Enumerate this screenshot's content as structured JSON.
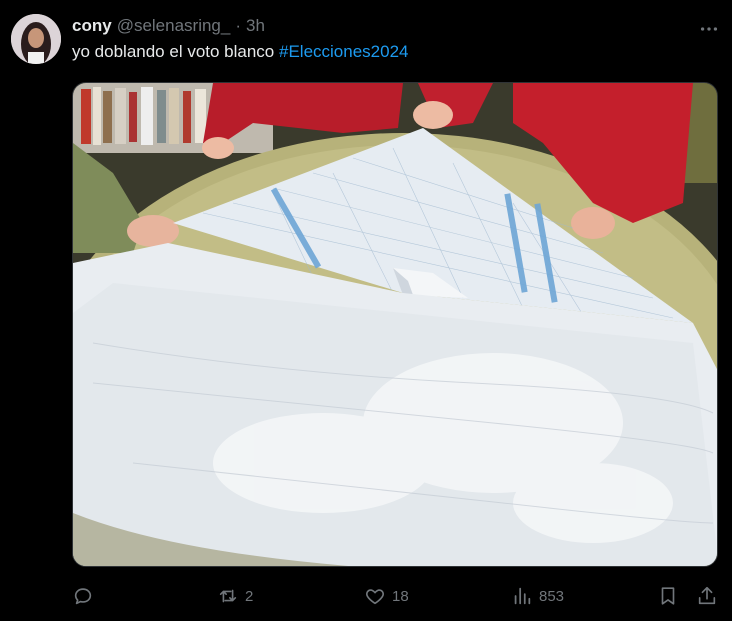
{
  "author": {
    "display_name": "cony",
    "handle": "@selenasring_",
    "separator": "·",
    "time": "3h"
  },
  "tweet": {
    "text": "yo doblando el voto blanco ",
    "hashtag": "#Elecciones2024"
  },
  "actions": {
    "replies": "",
    "retweets": "2",
    "likes": "18",
    "views": "853"
  },
  "colors": {
    "background": "#000000",
    "text": "#e7e9ea",
    "muted": "#71767b",
    "link": "#1d9bf0"
  },
  "icons": [
    "more-icon",
    "reply-icon",
    "retweet-icon",
    "like-icon",
    "views-icon",
    "bookmark-icon",
    "share-icon"
  ]
}
